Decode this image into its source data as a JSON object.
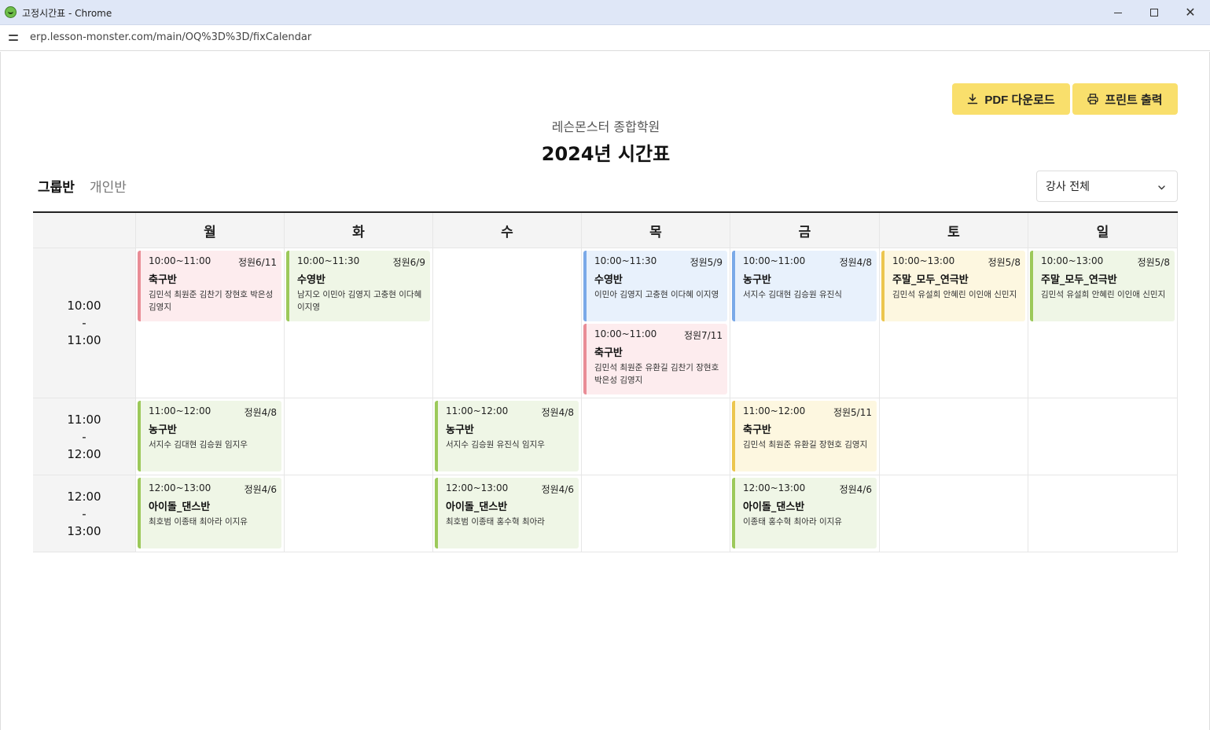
{
  "window": {
    "title": "고정시간표 - Chrome",
    "url": "erp.lesson-monster.com/main/OQ%3D%3D/fixCalendar"
  },
  "toolbar": {
    "pdf_label": "PDF 다운로드",
    "print_label": "프린트 출력"
  },
  "header": {
    "academy": "레슨몬스터 종합학원",
    "title": "2024년 시간표"
  },
  "tabs": {
    "group": "그룹반",
    "private": "개인반"
  },
  "filter": {
    "selected": "강사 전체"
  },
  "days": [
    "월",
    "화",
    "수",
    "목",
    "금",
    "토",
    "일"
  ],
  "slots": [
    {
      "start": "10:00",
      "sep": "-",
      "end": "11:00"
    },
    {
      "start": "11:00",
      "sep": "-",
      "end": "12:00"
    },
    {
      "start": "12:00",
      "sep": "-",
      "end": "13:00"
    }
  ],
  "classes": [
    {
      "time": "10:00~11:00",
      "capacity": "정원6/11",
      "name": "축구반",
      "students": "김민석 최원준 김찬기 장현호 박은성 김영지",
      "color": "#e98d96"
    },
    {
      "time": "10:00~11:30",
      "capacity": "정원6/9",
      "name": "수영반",
      "students": "남지오 이민아 김영지 고충현 이다혜 이지영",
      "color": "#9cc95a"
    },
    {
      "time": "10:00~11:30",
      "capacity": "정원5/9",
      "name": "수영반",
      "students": "이민아 김영지 고충현 이다혜 이지영",
      "color": "#7aa9e8"
    },
    {
      "time": "10:00~11:00",
      "capacity": "정원7/11",
      "name": "축구반",
      "students": "김민석 최원준 유환길 김찬기 장현호 박은성 김영지",
      "color": "#e98d96"
    },
    {
      "time": "10:00~11:00",
      "capacity": "정원4/8",
      "name": "농구반",
      "students": "서지수 김대현 김승원 유진식",
      "color": "#7aa9e8"
    },
    {
      "time": "10:00~13:00",
      "capacity": "정원5/8",
      "name": "주말_모두_연극반",
      "students": "김민석 유설희 안혜린 이인애 신민지",
      "color": "#ecc64e"
    },
    {
      "time": "10:00~13:00",
      "capacity": "정원5/8",
      "name": "주말_모두_연극반",
      "students": "김민석 유설희 안혜린 이인애 신민지",
      "color": "#9cc95a"
    },
    {
      "time": "11:00~12:00",
      "capacity": "정원4/8",
      "name": "농구반",
      "students": "서지수 김대현 김승원 임지우",
      "color": "#9cc95a"
    },
    {
      "time": "11:00~12:00",
      "capacity": "정원4/8",
      "name": "농구반",
      "students": "서지수 김승원 유진식 임지우",
      "color": "#9cc95a"
    },
    {
      "time": "11:00~12:00",
      "capacity": "정원5/11",
      "name": "축구반",
      "students": "김민석 최원준 유환길 장현호 김영지",
      "color": "#ecc64e"
    },
    {
      "time": "12:00~13:00",
      "capacity": "정원4/6",
      "name": "아이돌_댄스반",
      "students": "최호범 이종태 최아라 이지유",
      "color": "#9cc95a"
    },
    {
      "time": "12:00~13:00",
      "capacity": "정원4/6",
      "name": "아이돌_댄스반",
      "students": "최호범 이종태 홍수혁 최아라",
      "color": "#9cc95a"
    },
    {
      "time": "12:00~13:00",
      "capacity": "정원4/6",
      "name": "아이돌_댄스반",
      "students": "이종태 홍수혁 최아라 이지유",
      "color": "#9cc95a"
    }
  ]
}
